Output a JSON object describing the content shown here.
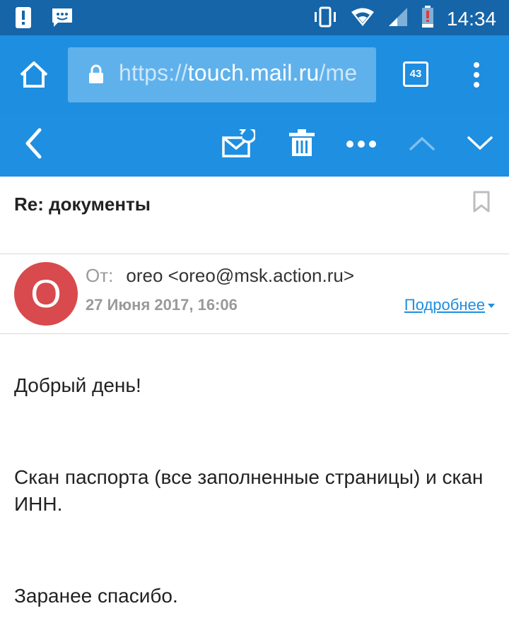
{
  "status_bar": {
    "time": "14:34",
    "icons": [
      "alert-icon",
      "message-icon",
      "vibrate-icon",
      "wifi-icon",
      "signal-icon",
      "battery-alert-icon"
    ]
  },
  "browser": {
    "url_scheme": "https://",
    "url_host": "touch.mail.ru",
    "url_rest": "/me",
    "tab_count": "43"
  },
  "toolbar": {
    "icons": [
      "back-icon",
      "mark-unread-icon",
      "delete-icon",
      "more-icon",
      "previous-icon",
      "next-icon"
    ]
  },
  "message": {
    "subject": "Re: документы",
    "avatar_letter": "O",
    "from_label": "От:",
    "from_value": "oreo <oreo@msk.action.ru>",
    "date": "27 Июня 2017, 16:06",
    "more_link": "Подробнее",
    "body": [
      "Добрый день!",
      "Скан паспорта (все заполненные страницы) и скан ИНН.",
      "Заранее спасибо."
    ]
  },
  "colors": {
    "status_bar": "#1565a8",
    "browser_bar": "#1e8ee0",
    "url_box": "#5fb1ec",
    "avatar": "#d84a4d",
    "link": "#1e8ee0"
  }
}
